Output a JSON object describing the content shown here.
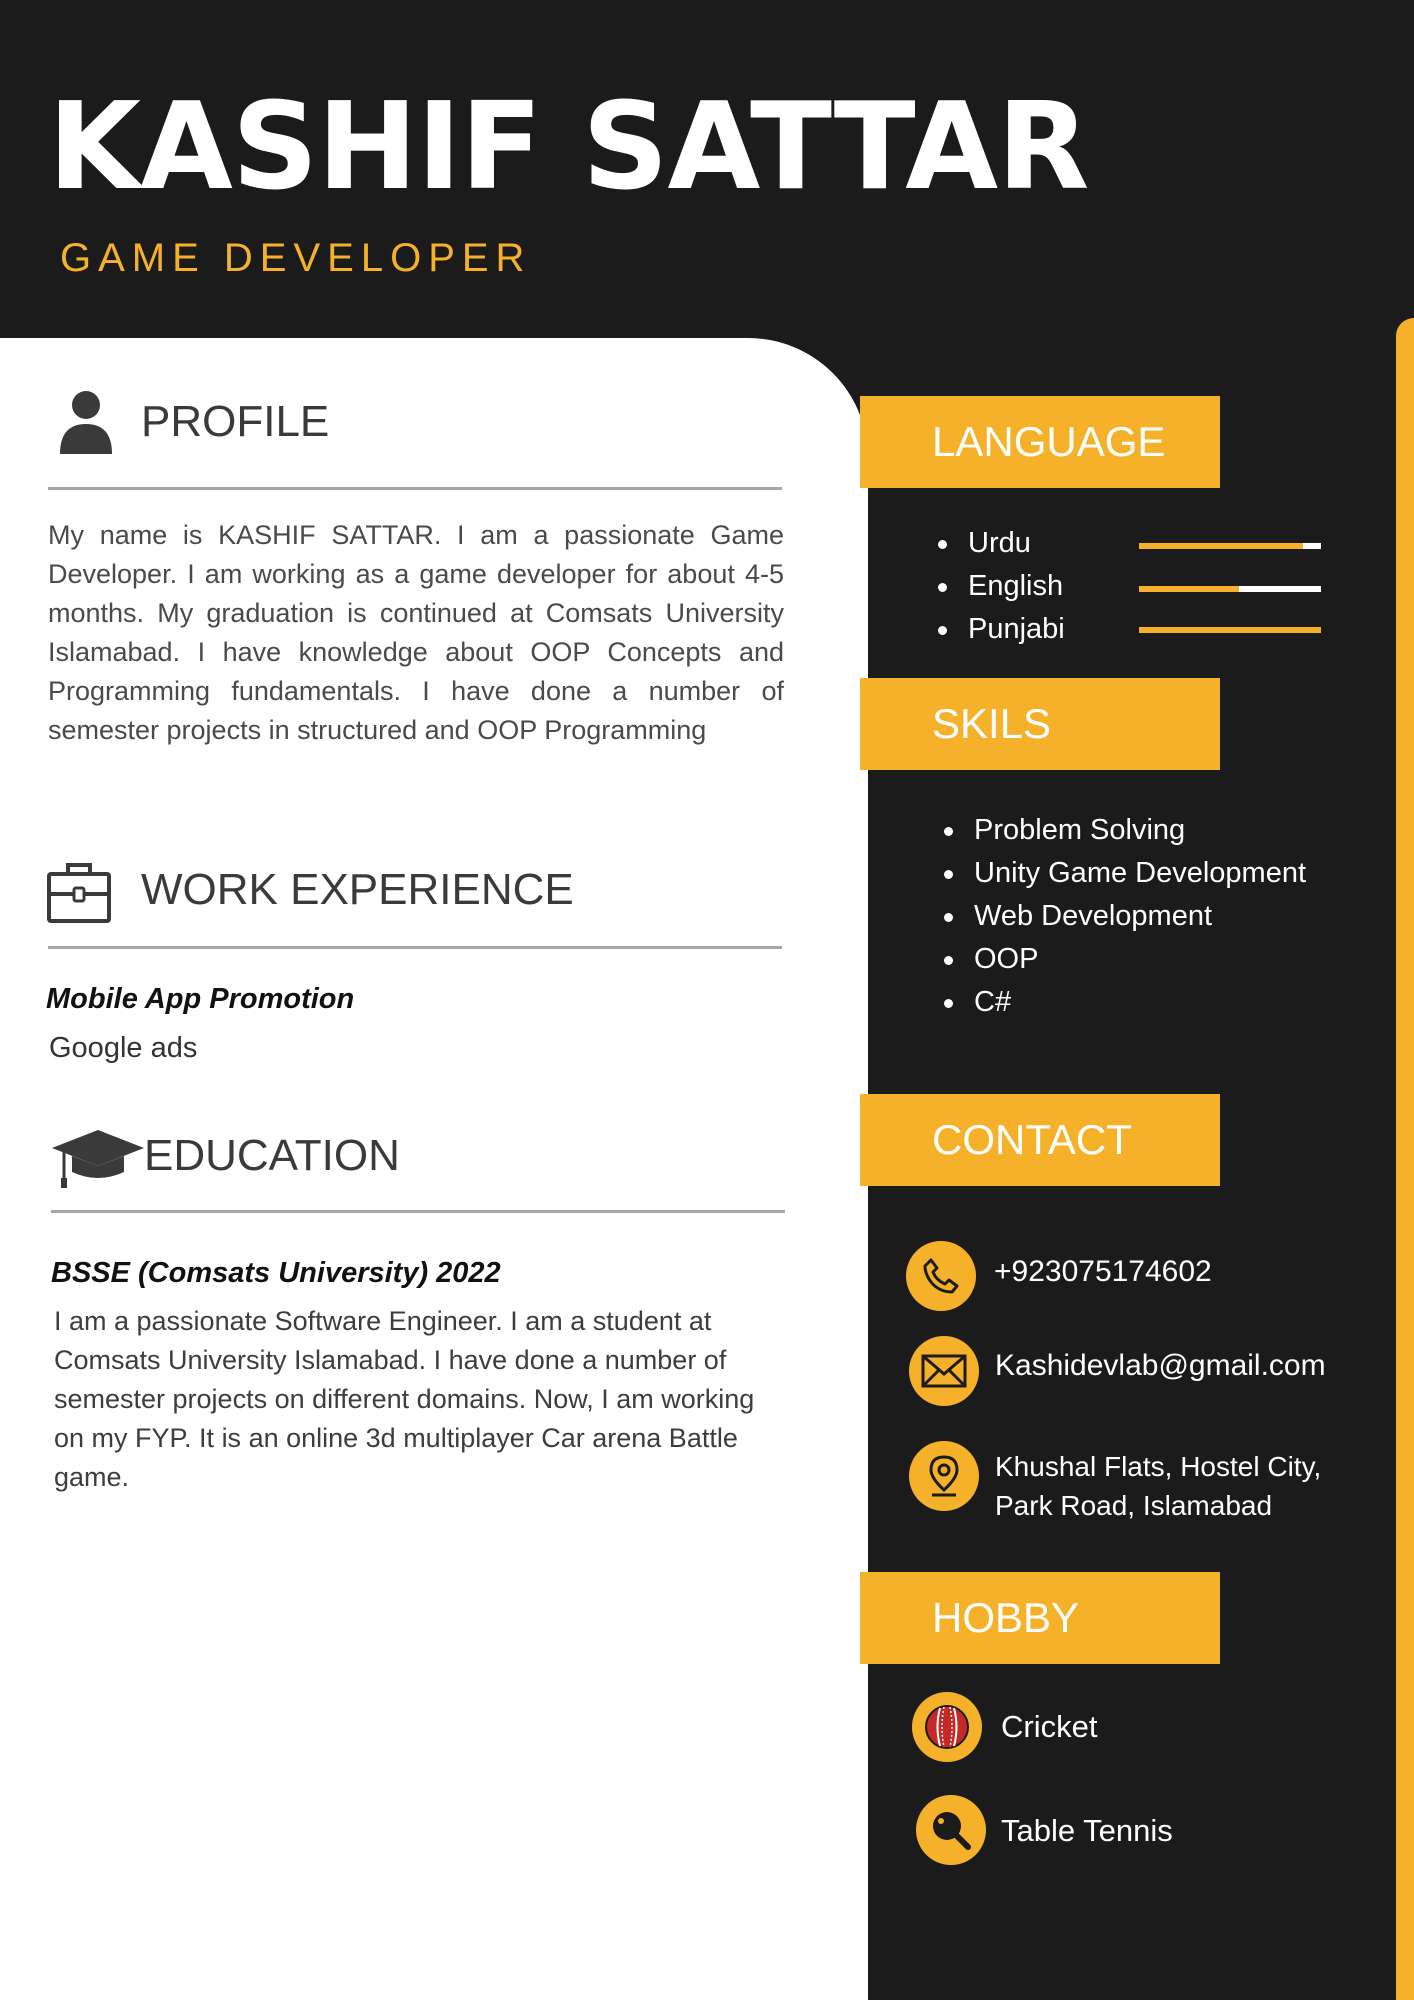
{
  "header": {
    "name": "KASHIF SATTAR",
    "role": "GAME DEVELOPER"
  },
  "profile": {
    "title": "PROFILE",
    "text": "My name is KASHIF SATTAR. I am a passionate Game Developer. I am working as a game developer for about 4-5 months. My graduation is continued at Comsats University Islamabad. I have knowledge about OOP Concepts and Programming fundamentals. I have done a number of semester projects in structured and OOP Programming"
  },
  "work": {
    "title": "WORK EXPERIENCE",
    "job_title": "Mobile App Promotion",
    "job_detail": "Google ads"
  },
  "education": {
    "title": "EDUCATION",
    "degree": "BSSE (Comsats University) 2022",
    "text": "I am a passionate Software Engineer. I am a student at Comsats University Islamabad. I have done a number of semester projects on different domains. Now, I am working on my FYP. It is an online 3d multiplayer Car arena Battle game."
  },
  "language": {
    "title": "LANGUAGE",
    "items": [
      {
        "label": "Urdu",
        "level": 0.9
      },
      {
        "label": "English",
        "level": 0.55
      },
      {
        "label": "Punjabi",
        "level": 1.0
      }
    ]
  },
  "skills": {
    "title": "SKILS",
    "items": [
      "Problem Solving",
      "Unity Game Development",
      "Web Development",
      "OOP",
      "C#"
    ]
  },
  "contact": {
    "title": "CONTACT",
    "phone": "+923075174602",
    "email": "Kashidevlab@gmail.com",
    "address_line1": "Khushal Flats, Hostel City,",
    "address_line2": "Park Road, Islamabad"
  },
  "hobby": {
    "title": "HOBBY",
    "items": [
      "Cricket",
      "Table Tennis"
    ]
  },
  "colors": {
    "accent": "#f6b12a",
    "dark": "#1b1b1b",
    "text": "#4a4a4a"
  }
}
